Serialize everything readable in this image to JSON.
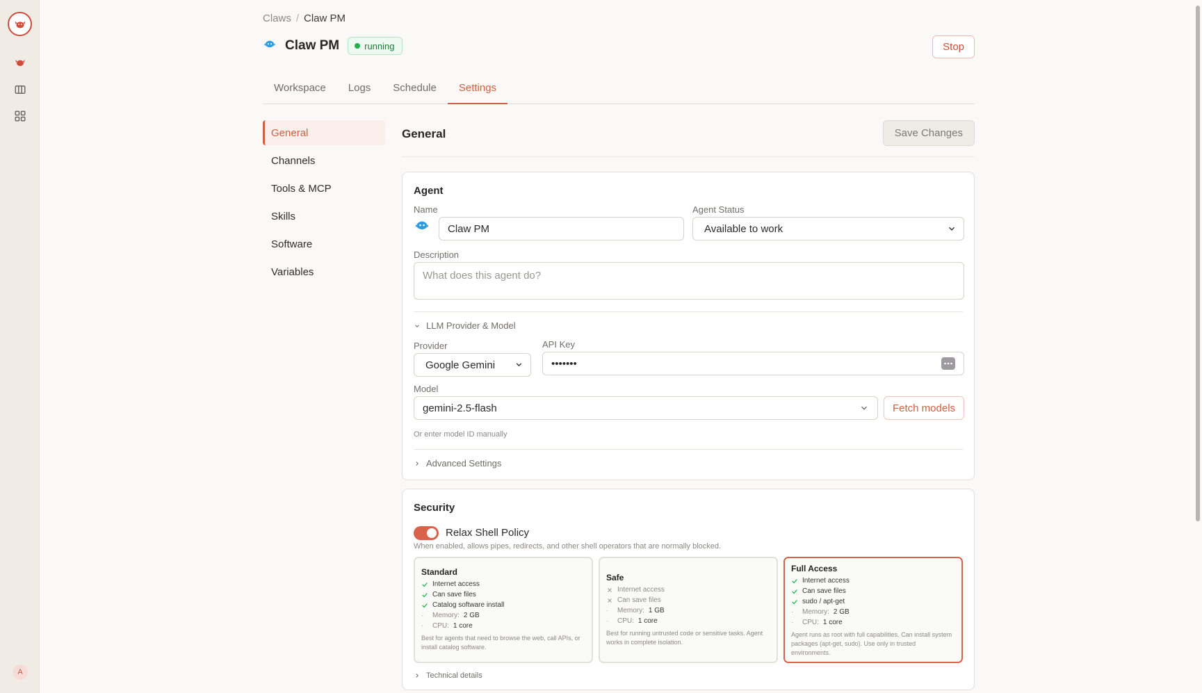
{
  "breadcrumb": {
    "parent": "Claws",
    "separator": "/",
    "current": "Claw PM"
  },
  "header": {
    "title": "Claw PM",
    "status": "running",
    "stop_label": "Stop"
  },
  "tabs": [
    "Workspace",
    "Logs",
    "Schedule",
    "Settings"
  ],
  "active_tab": "Settings",
  "sidebar": {
    "items": [
      "General",
      "Channels",
      "Tools & MCP",
      "Skills",
      "Software",
      "Variables"
    ],
    "active": "General"
  },
  "panel": {
    "title": "General",
    "save_label": "Save Changes"
  },
  "agent": {
    "section_title": "Agent",
    "name_label": "Name",
    "name_value": "Claw PM",
    "status_label": "Agent Status",
    "status_value": "Available to work",
    "description_label": "Description",
    "description_placeholder": "What does this agent do?",
    "llm_section": "LLM Provider & Model",
    "provider_label": "Provider",
    "provider_value": "Google Gemini",
    "api_key_label": "API Key",
    "api_key_value": "•••••••",
    "model_label": "Model",
    "model_value": "gemini-2.5-flash",
    "fetch_label": "Fetch models",
    "manual_hint": "Or enter model ID manually",
    "advanced_label": "Advanced Settings"
  },
  "security": {
    "section_title": "Security",
    "relax_label": "Relax Shell Policy",
    "relax_enabled": true,
    "relax_hint": "When enabled, allows pipes, redirects, and other shell operators that are normally blocked.",
    "tiers": [
      {
        "name": "Standard",
        "features": [
          {
            "text": "Internet access",
            "on": true
          },
          {
            "text": "Can save files",
            "on": true
          },
          {
            "text": "Catalog software install",
            "on": true
          }
        ],
        "memory_label": "Memory:",
        "memory": "2 GB",
        "cpu_label": "CPU:",
        "cpu": "1 core",
        "desc": "Best for agents that need to browse the web, call APIs, or install catalog software.",
        "selected": false
      },
      {
        "name": "Safe",
        "features": [
          {
            "text": "Internet access",
            "on": false
          },
          {
            "text": "Can save files",
            "on": false
          }
        ],
        "memory_label": "Memory:",
        "memory": "1 GB",
        "cpu_label": "CPU:",
        "cpu": "1 core",
        "desc": "Best for running untrusted code or sensitive tasks. Agent works in complete isolation.",
        "selected": false
      },
      {
        "name": "Full Access",
        "features": [
          {
            "text": "Internet access",
            "on": true
          },
          {
            "text": "Can save files",
            "on": true
          },
          {
            "text": "sudo / apt-get",
            "on": true
          }
        ],
        "memory_label": "Memory:",
        "memory": "2 GB",
        "cpu_label": "CPU:",
        "cpu": "1 core",
        "desc": "Agent runs as root with full capabilities. Can install system packages (apt-get, sudo). Use only in trusted environments.",
        "selected": true
      }
    ],
    "technical_label": "Technical details"
  },
  "user": {
    "initial": "A"
  },
  "colors": {
    "accent": "#d05f41",
    "success": "#22b14c",
    "brand": "#d04b3c",
    "agent_icon": "#2f9be0"
  },
  "icons": [
    "claw-logo-icon",
    "claw-icon",
    "board-icon",
    "grid-icon",
    "agent-avatar-icon",
    "check-icon",
    "x-icon",
    "chevron-down-icon",
    "chevron-right-icon",
    "password-toggle-icon"
  ]
}
